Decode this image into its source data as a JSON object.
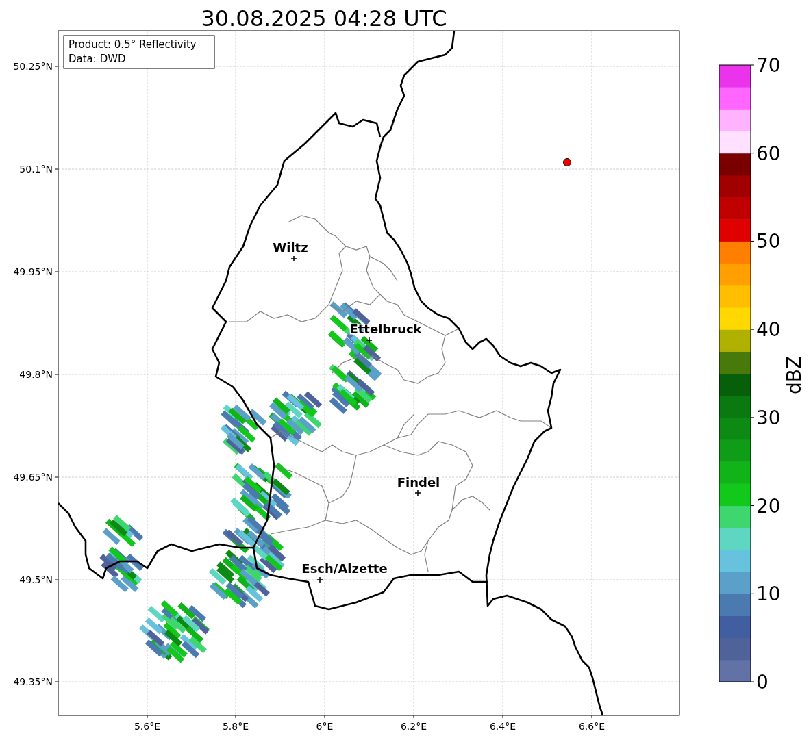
{
  "title": "30.08.2025 04:28 UTC",
  "info_box": [
    "Product: 0.5° Reflectivity",
    "Data: DWD"
  ],
  "map": {
    "lat_ticks": [
      "50.25°N",
      "50.1°N",
      "49.95°N",
      "49.8°N",
      "49.65°N",
      "49.5°N",
      "49.35°N"
    ],
    "lon_ticks": [
      "5.6°E",
      "5.8°E",
      "6°E",
      "6.2°E",
      "6.4°E",
      "6.6°E"
    ],
    "cities": [
      {
        "name": "Wiltz"
      },
      {
        "name": "Ettelbruck"
      },
      {
        "name": "Findel"
      },
      {
        "name": "Esch/Alzette"
      }
    ]
  },
  "colorbar": {
    "label": "dBZ",
    "ticks": [
      "70",
      "60",
      "50",
      "40",
      "30",
      "20",
      "10",
      "0"
    ],
    "segments": [
      {
        "color": "#6272a6"
      },
      {
        "color": "#50629a"
      },
      {
        "color": "#405ea0"
      },
      {
        "color": "#4b7ab0"
      },
      {
        "color": "#5aa0c8"
      },
      {
        "color": "#66c2dd"
      },
      {
        "color": "#5fd6c2"
      },
      {
        "color": "#3ed66e"
      },
      {
        "color": "#12c81a"
      },
      {
        "color": "#10b418"
      },
      {
        "color": "#0f9c17"
      },
      {
        "color": "#0c8a14"
      },
      {
        "color": "#0a7a10"
      },
      {
        "color": "#075f0a"
      },
      {
        "color": "#477a0a"
      },
      {
        "color": "#b0b000"
      },
      {
        "color": "#ffd800"
      },
      {
        "color": "#ffbf00"
      },
      {
        "color": "#ff9f00"
      },
      {
        "color": "#ff8000"
      },
      {
        "color": "#e00000"
      },
      {
        "color": "#c00000"
      },
      {
        "color": "#a00000"
      },
      {
        "color": "#7a0000"
      },
      {
        "color": "#ffe0ff"
      },
      {
        "color": "#ffb3ff"
      },
      {
        "color": "#ff66ff"
      },
      {
        "color": "#ea33ea"
      }
    ]
  }
}
